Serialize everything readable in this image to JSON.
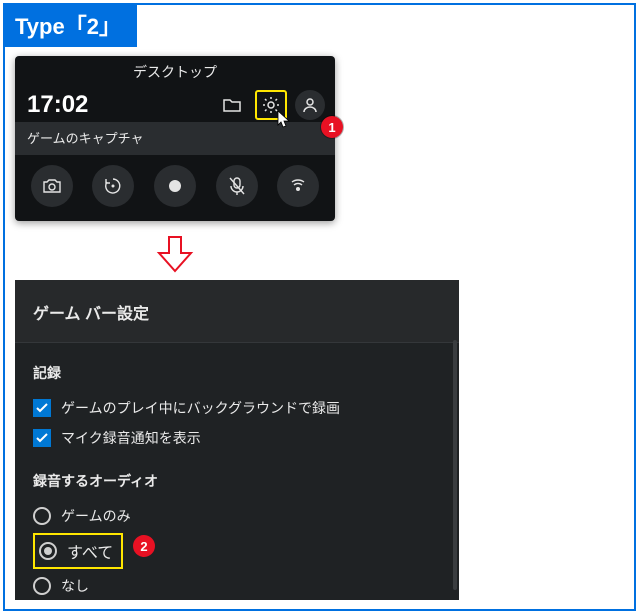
{
  "tab_label": "Type「2」",
  "gamebar": {
    "title": "デスクトップ",
    "time": "17:02",
    "subtitle": "ゲームのキャプチャ",
    "icons": {
      "folder": "folder-icon",
      "settings": "gear-icon",
      "account": "user-icon"
    },
    "controls": [
      {
        "name": "screenshot-button",
        "icon": "camera-icon"
      },
      {
        "name": "record-last-button",
        "icon": "rewind-icon"
      },
      {
        "name": "record-button",
        "icon": "record-icon"
      },
      {
        "name": "mic-toggle-button",
        "icon": "mic-off-icon"
      },
      {
        "name": "broadcast-button",
        "icon": "broadcast-icon"
      }
    ]
  },
  "callouts": {
    "one": "1",
    "two": "2"
  },
  "settings": {
    "title": "ゲーム バー設定",
    "record_section": "記録",
    "checkboxes": [
      {
        "label": "ゲームのプレイ中にバックグラウンドで録画",
        "checked": true
      },
      {
        "label": "マイク録音通知を表示",
        "checked": true
      }
    ],
    "audio_section": "録音するオーディオ",
    "radios": [
      {
        "label": "ゲームのみ",
        "checked": false,
        "highlight": false
      },
      {
        "label": "すべて",
        "checked": true,
        "highlight": true
      },
      {
        "label": "なし",
        "checked": false,
        "highlight": false
      }
    ]
  }
}
